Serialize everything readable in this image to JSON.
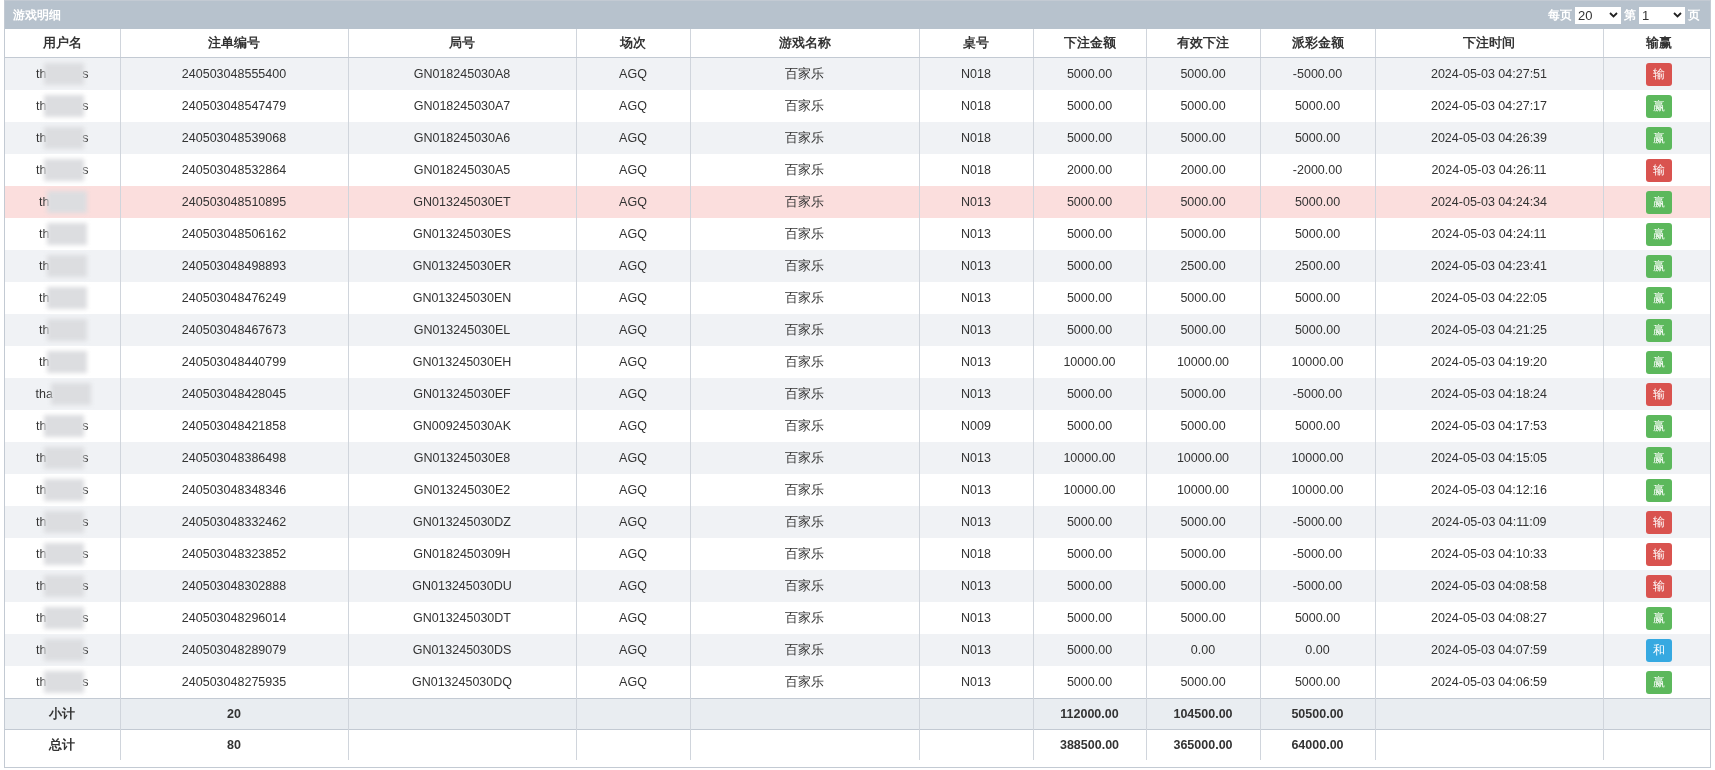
{
  "panel": {
    "title": "游戏明细",
    "per_page_label": "每页",
    "per_page": "20",
    "page_label_before": "第",
    "page": "1",
    "page_label_after": "页"
  },
  "table": {
    "columns": [
      "用户名",
      "注单编号",
      "局号",
      "场次",
      "游戏名称",
      "桌号",
      "下注金额",
      "有效下注",
      "派彩金额",
      "下注时间",
      "输赢"
    ],
    "rows": [
      {
        "user_start": "th",
        "user_end": "s",
        "bet_id": "240503048555400",
        "round": "GN018245030A8",
        "session": "AGQ",
        "game": "百家乐",
        "table": "N018",
        "bet": "5000.00",
        "valid": "5000.00",
        "payout": "-5000.00",
        "time": "2024-05-03 04:27:51",
        "result": "输",
        "kind": "lose",
        "selected": false
      },
      {
        "user_start": "th",
        "user_end": "s",
        "bet_id": "240503048547479",
        "round": "GN018245030A7",
        "session": "AGQ",
        "game": "百家乐",
        "table": "N018",
        "bet": "5000.00",
        "valid": "5000.00",
        "payout": "5000.00",
        "time": "2024-05-03 04:27:17",
        "result": "赢",
        "kind": "win",
        "selected": false
      },
      {
        "user_start": "th",
        "user_end": "s",
        "bet_id": "240503048539068",
        "round": "GN018245030A6",
        "session": "AGQ",
        "game": "百家乐",
        "table": "N018",
        "bet": "5000.00",
        "valid": "5000.00",
        "payout": "5000.00",
        "time": "2024-05-03 04:26:39",
        "result": "赢",
        "kind": "win",
        "selected": false
      },
      {
        "user_start": "th",
        "user_end": "s",
        "bet_id": "240503048532864",
        "round": "GN018245030A5",
        "session": "AGQ",
        "game": "百家乐",
        "table": "N018",
        "bet": "2000.00",
        "valid": "2000.00",
        "payout": "-2000.00",
        "time": "2024-05-03 04:26:11",
        "result": "输",
        "kind": "lose",
        "selected": false
      },
      {
        "user_start": "th",
        "bet_id": "240503048510895",
        "round": "GN013245030ET",
        "session": "AGQ",
        "game": "百家乐",
        "table": "N013",
        "bet": "5000.00",
        "valid": "5000.00",
        "payout": "5000.00",
        "time": "2024-05-03 04:24:34",
        "result": "赢",
        "kind": "win",
        "selected": true
      },
      {
        "user_start": "th",
        "bet_id": "240503048506162",
        "round": "GN013245030ES",
        "session": "AGQ",
        "game": "百家乐",
        "table": "N013",
        "bet": "5000.00",
        "valid": "5000.00",
        "payout": "5000.00",
        "time": "2024-05-03 04:24:11",
        "result": "赢",
        "kind": "win",
        "selected": false
      },
      {
        "user_start": "th",
        "bet_id": "240503048498893",
        "round": "GN013245030ER",
        "session": "AGQ",
        "game": "百家乐",
        "table": "N013",
        "bet": "5000.00",
        "valid": "2500.00",
        "payout": "2500.00",
        "time": "2024-05-03 04:23:41",
        "result": "赢",
        "kind": "win",
        "selected": false
      },
      {
        "user_start": "th",
        "bet_id": "240503048476249",
        "round": "GN013245030EN",
        "session": "AGQ",
        "game": "百家乐",
        "table": "N013",
        "bet": "5000.00",
        "valid": "5000.00",
        "payout": "5000.00",
        "time": "2024-05-03 04:22:05",
        "result": "赢",
        "kind": "win",
        "selected": false
      },
      {
        "user_start": "th",
        "bet_id": "240503048467673",
        "round": "GN013245030EL",
        "session": "AGQ",
        "game": "百家乐",
        "table": "N013",
        "bet": "5000.00",
        "valid": "5000.00",
        "payout": "5000.00",
        "time": "2024-05-03 04:21:25",
        "result": "赢",
        "kind": "win",
        "selected": false
      },
      {
        "user_start": "th",
        "bet_id": "240503048440799",
        "round": "GN013245030EH",
        "session": "AGQ",
        "game": "百家乐",
        "table": "N013",
        "bet": "10000.00",
        "valid": "10000.00",
        "payout": "10000.00",
        "time": "2024-05-03 04:19:20",
        "result": "赢",
        "kind": "win",
        "selected": false
      },
      {
        "user_start": "tha",
        "bet_id": "240503048428045",
        "round": "GN013245030EF",
        "session": "AGQ",
        "game": "百家乐",
        "table": "N013",
        "bet": "5000.00",
        "valid": "5000.00",
        "payout": "-5000.00",
        "time": "2024-05-03 04:18:24",
        "result": "输",
        "kind": "lose",
        "selected": false
      },
      {
        "user_start": "th",
        "user_end": "s",
        "bet_id": "240503048421858",
        "round": "GN009245030AK",
        "session": "AGQ",
        "game": "百家乐",
        "table": "N009",
        "bet": "5000.00",
        "valid": "5000.00",
        "payout": "5000.00",
        "time": "2024-05-03 04:17:53",
        "result": "赢",
        "kind": "win",
        "selected": false
      },
      {
        "user_start": "th",
        "user_end": "s",
        "bet_id": "240503048386498",
        "round": "GN013245030E8",
        "session": "AGQ",
        "game": "百家乐",
        "table": "N013",
        "bet": "10000.00",
        "valid": "10000.00",
        "payout": "10000.00",
        "time": "2024-05-03 04:15:05",
        "result": "赢",
        "kind": "win",
        "selected": false
      },
      {
        "user_start": "th",
        "user_end": "s",
        "bet_id": "240503048348346",
        "round": "GN013245030E2",
        "session": "AGQ",
        "game": "百家乐",
        "table": "N013",
        "bet": "10000.00",
        "valid": "10000.00",
        "payout": "10000.00",
        "time": "2024-05-03 04:12:16",
        "result": "赢",
        "kind": "win",
        "selected": false
      },
      {
        "user_start": "th",
        "user_end": "s",
        "bet_id": "240503048332462",
        "round": "GN013245030DZ",
        "session": "AGQ",
        "game": "百家乐",
        "table": "N013",
        "bet": "5000.00",
        "valid": "5000.00",
        "payout": "-5000.00",
        "time": "2024-05-03 04:11:09",
        "result": "输",
        "kind": "lose",
        "selected": false
      },
      {
        "user_start": "th",
        "user_end": "s",
        "bet_id": "240503048323852",
        "round": "GN0182450309H",
        "session": "AGQ",
        "game": "百家乐",
        "table": "N018",
        "bet": "5000.00",
        "valid": "5000.00",
        "payout": "-5000.00",
        "time": "2024-05-03 04:10:33",
        "result": "输",
        "kind": "lose",
        "selected": false
      },
      {
        "user_start": "th",
        "user_end": "s",
        "bet_id": "240503048302888",
        "round": "GN013245030DU",
        "session": "AGQ",
        "game": "百家乐",
        "table": "N013",
        "bet": "5000.00",
        "valid": "5000.00",
        "payout": "-5000.00",
        "time": "2024-05-03 04:08:58",
        "result": "输",
        "kind": "lose",
        "selected": false
      },
      {
        "user_start": "th",
        "user_end": "s",
        "bet_id": "240503048296014",
        "round": "GN013245030DT",
        "session": "AGQ",
        "game": "百家乐",
        "table": "N013",
        "bet": "5000.00",
        "valid": "5000.00",
        "payout": "5000.00",
        "time": "2024-05-03 04:08:27",
        "result": "赢",
        "kind": "win",
        "selected": false
      },
      {
        "user_start": "th",
        "user_end": "s",
        "bet_id": "240503048289079",
        "round": "GN013245030DS",
        "session": "AGQ",
        "game": "百家乐",
        "table": "N013",
        "bet": "5000.00",
        "valid": "0.00",
        "payout": "0.00",
        "time": "2024-05-03 04:07:59",
        "result": "和",
        "kind": "tie",
        "selected": false
      },
      {
        "user_start": "th",
        "user_end": "s",
        "bet_id": "240503048275935",
        "round": "GN013245030DQ",
        "session": "AGQ",
        "game": "百家乐",
        "table": "N013",
        "bet": "5000.00",
        "valid": "5000.00",
        "payout": "5000.00",
        "time": "2024-05-03 04:06:59",
        "result": "赢",
        "kind": "win",
        "selected": false
      }
    ],
    "summary": [
      {
        "label": "小计",
        "count": "20",
        "bet": "112000.00",
        "valid": "104500.00",
        "payout": "50500.00"
      },
      {
        "label": "总计",
        "count": "80",
        "bet": "388500.00",
        "valid": "365000.00",
        "payout": "64000.00"
      }
    ]
  }
}
